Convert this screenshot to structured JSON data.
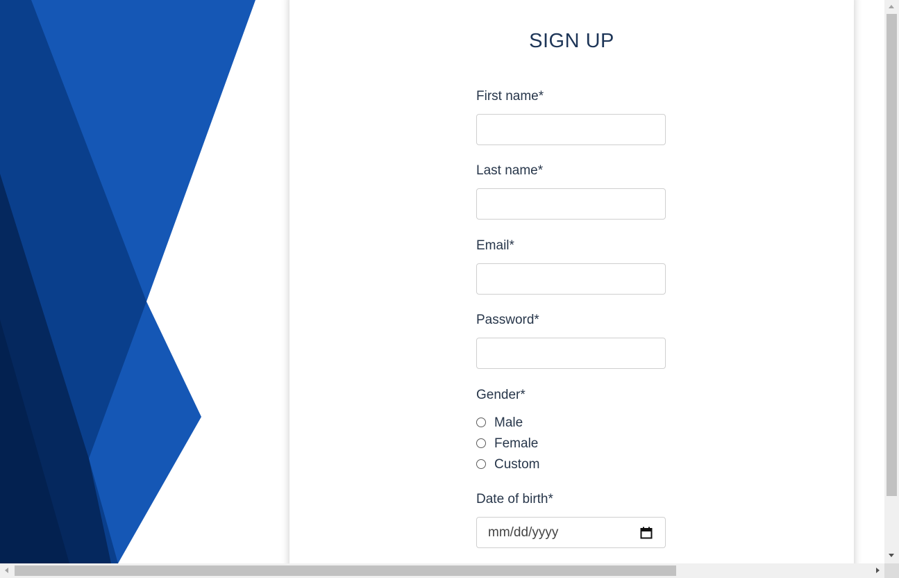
{
  "page": {
    "title": "SIGN UP"
  },
  "form": {
    "first_name": {
      "label": "First name*",
      "value": ""
    },
    "last_name": {
      "label": "Last name*",
      "value": ""
    },
    "email": {
      "label": "Email*",
      "value": ""
    },
    "password": {
      "label": "Password*",
      "value": ""
    },
    "gender": {
      "label": "Gender*",
      "options": [
        "Male",
        "Female",
        "Custom"
      ],
      "selected": null
    },
    "date_of_birth": {
      "label": "Date of birth*",
      "placeholder": "mm/dd/yyyy"
    }
  },
  "colors": {
    "accent_blue": "#1557b5",
    "dark_blue": "#0a3f8c",
    "navy": "#05285e",
    "text": "#27364a"
  }
}
